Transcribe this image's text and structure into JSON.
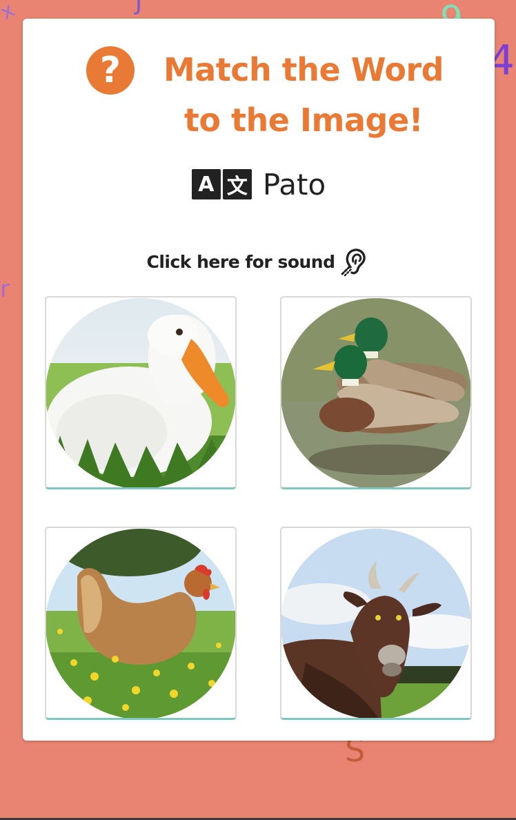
{
  "header": {
    "title": "Match the Word to the Image!",
    "help_icon": "question-circle-icon",
    "accent_color": "#e87a35"
  },
  "word": {
    "icon": "translate-icon",
    "icon_left_glyph": "A",
    "icon_right_glyph": "文",
    "text": "Pato"
  },
  "sound": {
    "label": "Click here for sound",
    "icon": "ear-hearing-icon"
  },
  "options": [
    {
      "image": "white-goose-photo"
    },
    {
      "image": "mallard-ducks-photo"
    },
    {
      "image": "hen-photo"
    },
    {
      "image": "goat-photo"
    }
  ],
  "colors": {
    "background": "#e98472",
    "card": "#ffffff",
    "option_underline": "#7fc6c2"
  }
}
